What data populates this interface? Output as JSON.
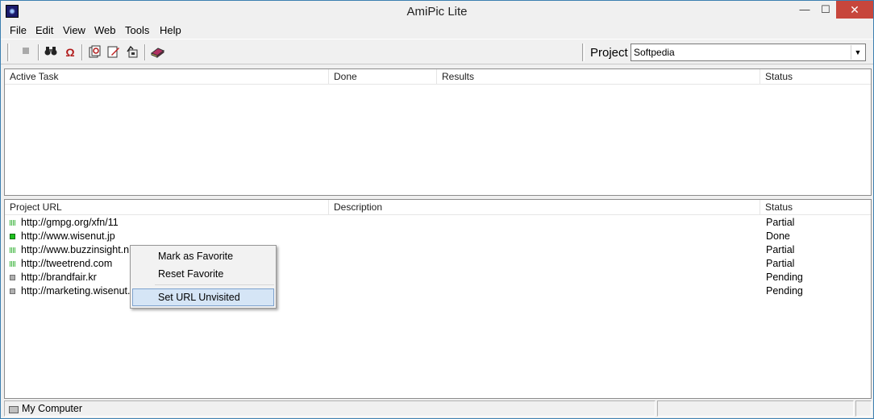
{
  "window": {
    "title": "AmiPic Lite",
    "min": "—",
    "max": "☐",
    "close": "✕"
  },
  "menu": [
    "File",
    "Edit",
    "View",
    "Web",
    "Tools",
    "Help"
  ],
  "toolbar": {
    "icons": [
      "stop-icon",
      "binoculars-icon",
      "omega-icon",
      "find-document-icon",
      "edit-icon",
      "export-icon",
      "book-icon"
    ],
    "project_label": "Project",
    "project_value": "Softpedia"
  },
  "tasks": {
    "columns": [
      "Active Task",
      "Done",
      "Results",
      "Status"
    ],
    "rows": []
  },
  "urls": {
    "columns": [
      "Project URL",
      "Description",
      "Status"
    ],
    "rows": [
      {
        "url": "http://gmpg.org/xfn/11",
        "status": "Partial",
        "icon": "partial"
      },
      {
        "url": "http://www.wisenut.jp",
        "status": "Done",
        "icon": "done"
      },
      {
        "url": "http://www.buzzinsight.n",
        "status": "Partial",
        "icon": "partial"
      },
      {
        "url": "http://tweetrend.com",
        "status": "Partial",
        "icon": "partial"
      },
      {
        "url": "http://brandfair.kr",
        "status": "Pending",
        "icon": "pending"
      },
      {
        "url": "http://marketing.wisenut.",
        "status": "Pending",
        "icon": "pending"
      }
    ]
  },
  "context_menu": {
    "items": [
      "Mark as Favorite",
      "Reset Favorite",
      "Set URL Unvisited"
    ],
    "highlighted": "Set URL Unvisited"
  },
  "statusbar": {
    "text": "My Computer"
  }
}
